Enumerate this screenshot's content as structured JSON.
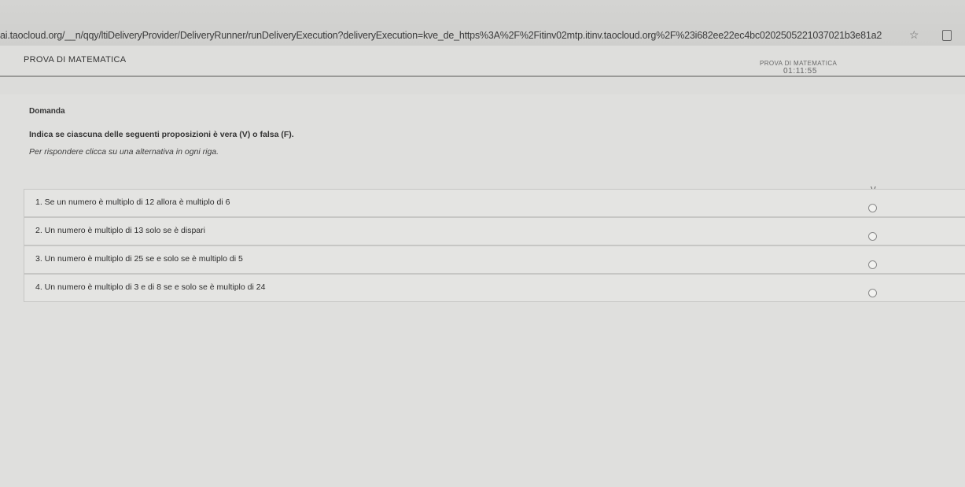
{
  "browser": {
    "url": "ai.taocloud.org/__n/qqy/ltiDeliveryProvider/DeliveryRunner/runDeliveryExecution?deliveryExecution=kve_de_https%3A%2F%2Fitinv02mtp.itinv.taocloud.org%2F%23i682ee22ec4bc0202505221037021b3e81a2",
    "star_icon": "star-icon",
    "extension_icon": "extension-icon"
  },
  "header": {
    "title": "PROVA DI MATEMATICA",
    "timer_label": "PROVA DI MATEMATICA",
    "timer_value": "01:11:55"
  },
  "question": {
    "section_title": "Domanda",
    "prompt": "Indica se ciascuna delle seguenti proposizioni è vera (V) o falsa (F).",
    "instruction": "Per rispondere clicca su una alternativa in ogni riga.",
    "column_v": "V",
    "rows": [
      {
        "text": "1. Se un numero è multiplo di 12  allora è multiplo di 6"
      },
      {
        "text": "2. Un numero è multiplo di 13  solo se è dispari"
      },
      {
        "text": "3. Un numero è multiplo di 25  se e solo se è multiplo di 5"
      },
      {
        "text": "4. Un numero è multiplo di 3  e di 8  se e solo se è multiplo di 24"
      }
    ]
  }
}
